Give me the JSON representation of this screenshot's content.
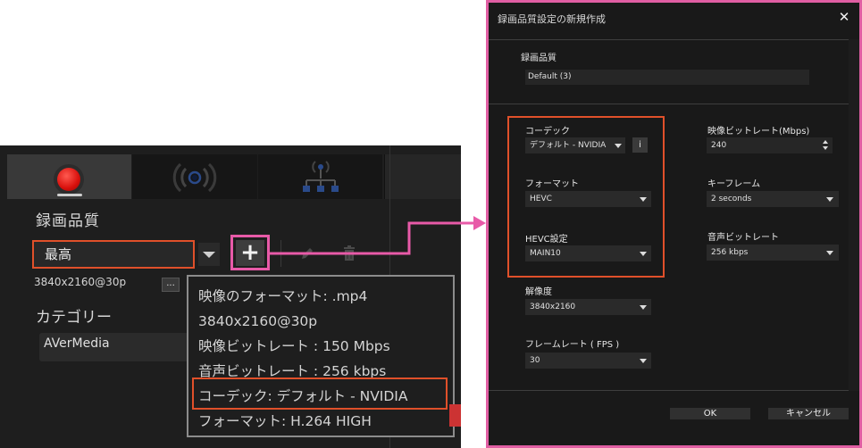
{
  "app": {
    "recording_quality_label": "録画品質",
    "quality_value": "最高",
    "add_button_label": "+",
    "resolution_text": "3840x2160@30p",
    "more_button_label": "...",
    "category_label": "カテゴリー",
    "category_value": "AVerMedia",
    "tooltip": {
      "lines": [
        "映像のフォーマット: .mp4",
        "3840x2160@30p",
        "映像ビットレート : 150 Mbps",
        "音声ビットレート : 256 kbps",
        "コーデック: デフォルト - NVIDIA",
        "フォーマット: H.264 HIGH"
      ]
    },
    "tabs": [
      "record-tab",
      "stream-tab",
      "network-tab"
    ]
  },
  "dialog": {
    "title": "録画品質設定の新規作成",
    "close_label": "✕",
    "quality_section_label": "録画品質",
    "name_value": "Default (3)",
    "codec_label": "コーデック",
    "codec_value": "デフォルト - NVIDIA",
    "info_label": "i",
    "format_label": "フォーマット",
    "format_value": "HEVC",
    "hevc_label": "HEVC設定",
    "hevc_value": "MAIN10",
    "resolution_label": "解像度",
    "resolution_value": "3840x2160",
    "framerate_label": "フレームレート ( FPS )",
    "framerate_value": "30",
    "video_bitrate_label": "映像ビットレート(Mbps)",
    "video_bitrate_value": "240",
    "keyframe_label": "キーフレーム",
    "keyframe_value": "2 seconds",
    "audio_bitrate_label": "音声ビットレート",
    "audio_bitrate_value": "256 kbps",
    "ok_label": "OK",
    "cancel_label": "キャンセル"
  },
  "colors": {
    "highlight_orange": "#e0502a",
    "highlight_pink": "#e85aa8",
    "record_red": "#d8100c",
    "panel_bg": "#1e1e1e",
    "dialog_bg": "#191919"
  }
}
